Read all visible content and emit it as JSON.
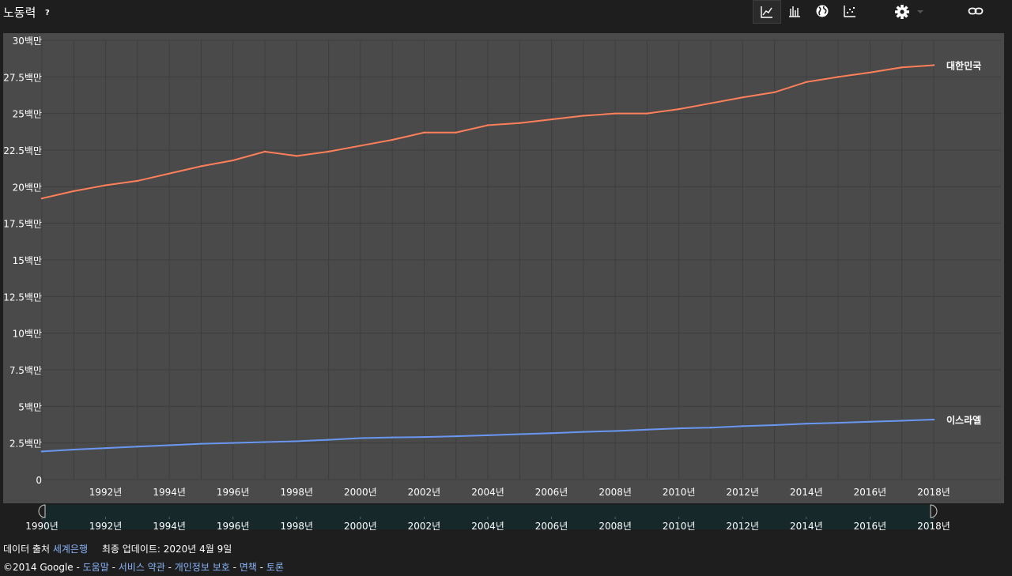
{
  "header": {
    "title": "노동력",
    "help": "?",
    "buttons": [
      {
        "name": "line-chart-button",
        "icon": "line-chart-icon",
        "active": true
      },
      {
        "name": "bar-chart-button",
        "icon": "bar-chart-icon",
        "active": false
      },
      {
        "name": "map-button",
        "icon": "globe-icon",
        "active": false
      },
      {
        "name": "scatter-button",
        "icon": "scatter-plot-icon",
        "active": false
      },
      {
        "name": "settings-button",
        "icon": "gear-icon",
        "active": false
      },
      {
        "name": "link-button",
        "icon": "link-icon",
        "active": false
      }
    ]
  },
  "colors": {
    "background": "#1e1e1e",
    "plot_background": "#4a4a4a",
    "korea": "#ff7f5a",
    "israel": "#6a97f2",
    "link": "#8ab4f8"
  },
  "chart_data": {
    "type": "line",
    "title": "노동력",
    "x": [
      1990,
      1991,
      1992,
      1993,
      1994,
      1995,
      1996,
      1997,
      1998,
      1999,
      2000,
      2001,
      2002,
      2003,
      2004,
      2005,
      2006,
      2007,
      2008,
      2009,
      2010,
      2011,
      2012,
      2013,
      2014,
      2015,
      2016,
      2017,
      2018
    ],
    "series": [
      {
        "name": "대한민국",
        "color": "#ff7f5a",
        "values": [
          19.2,
          19.7,
          20.1,
          20.4,
          20.9,
          21.4,
          21.8,
          22.4,
          22.1,
          22.4,
          22.8,
          23.2,
          23.7,
          23.7,
          24.2,
          24.35,
          24.6,
          24.85,
          25.0,
          25.0,
          25.3,
          25.7,
          26.1,
          26.45,
          27.15,
          27.5,
          27.8,
          28.15,
          28.3
        ]
      },
      {
        "name": "이스라엘",
        "color": "#6a97f2",
        "values": [
          1.92,
          2.05,
          2.15,
          2.25,
          2.35,
          2.45,
          2.5,
          2.56,
          2.62,
          2.72,
          2.83,
          2.88,
          2.91,
          2.96,
          3.03,
          3.1,
          3.17,
          3.26,
          3.32,
          3.41,
          3.5,
          3.55,
          3.65,
          3.72,
          3.82,
          3.88,
          3.95,
          4.02,
          4.1
        ]
      }
    ],
    "xlim": [
      1990,
      2018
    ],
    "ylim": [
      0,
      30
    ],
    "y_ticks": [
      {
        "value": 0,
        "label": "0"
      },
      {
        "value": 2.5,
        "label": "2.5백만"
      },
      {
        "value": 5,
        "label": "5백만"
      },
      {
        "value": 7.5,
        "label": "7.5백만"
      },
      {
        "value": 10,
        "label": "10백만"
      },
      {
        "value": 12.5,
        "label": "12.5백만"
      },
      {
        "value": 15,
        "label": "15백만"
      },
      {
        "value": 17.5,
        "label": "17.5백만"
      },
      {
        "value": 20,
        "label": "20백만"
      },
      {
        "value": 22.5,
        "label": "22.5백만"
      },
      {
        "value": 25,
        "label": "25백만"
      },
      {
        "value": 27.5,
        "label": "27.5백만"
      },
      {
        "value": 30,
        "label": "30백만"
      }
    ],
    "x_ticks": [
      {
        "value": 1992,
        "label": "1992년"
      },
      {
        "value": 1994,
        "label": "1994년"
      },
      {
        "value": 1996,
        "label": "1996년"
      },
      {
        "value": 1998,
        "label": "1998년"
      },
      {
        "value": 2000,
        "label": "2000년"
      },
      {
        "value": 2002,
        "label": "2002년"
      },
      {
        "value": 2004,
        "label": "2004년"
      },
      {
        "value": 2006,
        "label": "2006년"
      },
      {
        "value": 2008,
        "label": "2008년"
      },
      {
        "value": 2010,
        "label": "2010년"
      },
      {
        "value": 2012,
        "label": "2012년"
      },
      {
        "value": 2014,
        "label": "2014년"
      },
      {
        "value": 2016,
        "label": "2016년"
      },
      {
        "value": 2018,
        "label": "2018년"
      }
    ],
    "grid": true,
    "legend": "inline-right"
  },
  "timeline": {
    "labels": [
      "1990년",
      "1992년",
      "1994년",
      "1996년",
      "1998년",
      "2000년",
      "2002년",
      "2004년",
      "2006년",
      "2008년",
      "2010년",
      "2012년",
      "2014년",
      "2016년",
      "2018년"
    ],
    "start_year": 1990,
    "end_year": 2018,
    "range": [
      1990,
      2018
    ]
  },
  "footer": {
    "source_label": "데이터 출처",
    "source_link": "세계은행",
    "updated": "최종 업데이트: 2020년 4월 9일",
    "copyright": "©2014 Google",
    "sep": " - ",
    "links": [
      "도움말",
      "서비스 약관",
      "개인정보 보호",
      "면책",
      "토론"
    ]
  }
}
